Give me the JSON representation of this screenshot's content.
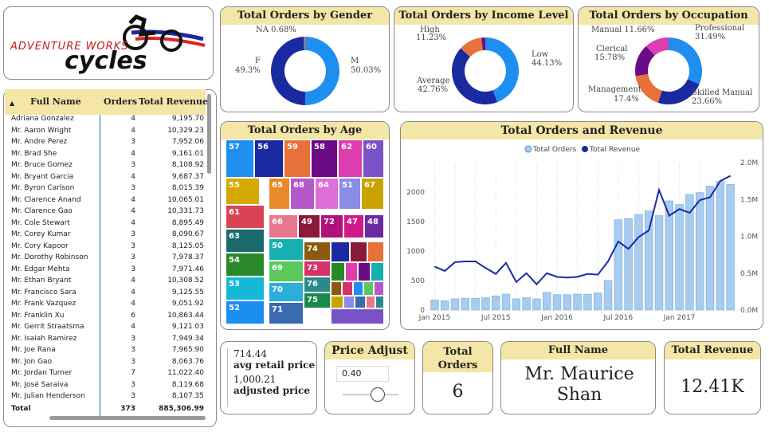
{
  "logo": {
    "line1": "ADVENTURE WORKS",
    "line2": "cycles"
  },
  "table": {
    "headers": {
      "name": "Full Name",
      "orders": "Orders",
      "revenue": "Total Revenue"
    },
    "rows": [
      {
        "name": "Adriana Gonzalez",
        "orders": "4",
        "revenue": "9,195.70"
      },
      {
        "name": "Mr. Aaron Wright",
        "orders": "4",
        "revenue": "10,329.23"
      },
      {
        "name": "Mr. Andre Perez",
        "orders": "3",
        "revenue": "7,952.06"
      },
      {
        "name": "Mr. Brad She",
        "orders": "4",
        "revenue": "9,161.01"
      },
      {
        "name": "Mr. Bruce Gomez",
        "orders": "3",
        "revenue": "8,108.92"
      },
      {
        "name": "Mr. Bryant Garcia",
        "orders": "4",
        "revenue": "9,687.37"
      },
      {
        "name": "Mr. Byron Carlson",
        "orders": "3",
        "revenue": "8,015.39"
      },
      {
        "name": "Mr. Clarence Anand",
        "orders": "4",
        "revenue": "10,065.01"
      },
      {
        "name": "Mr. Clarence Gao",
        "orders": "4",
        "revenue": "10,331.73"
      },
      {
        "name": "Mr. Cole Stewart",
        "orders": "4",
        "revenue": "8,895.49"
      },
      {
        "name": "Mr. Corey Kumar",
        "orders": "3",
        "revenue": "8,090.67"
      },
      {
        "name": "Mr. Cory Kapoor",
        "orders": "3",
        "revenue": "8,125.05"
      },
      {
        "name": "Mr. Dorothy Robinson",
        "orders": "3",
        "revenue": "7,978.37"
      },
      {
        "name": "Mr. Edgar Mehta",
        "orders": "3",
        "revenue": "7,971.46"
      },
      {
        "name": "Mr. Ethan Bryant",
        "orders": "4",
        "revenue": "10,308.52"
      },
      {
        "name": "Mr. Francisco Sara",
        "orders": "4",
        "revenue": "9,125.55"
      },
      {
        "name": "Mr. Frank Vazquez",
        "orders": "4",
        "revenue": "9,051.92"
      },
      {
        "name": "Mr. Franklin Xu",
        "orders": "6",
        "revenue": "10,863.44"
      },
      {
        "name": "Mr. Gerrit Straatsma",
        "orders": "4",
        "revenue": "9,121.03"
      },
      {
        "name": "Mr. Isaiah Ramirez",
        "orders": "3",
        "revenue": "7,949.34"
      },
      {
        "name": "Mr. Joe Rana",
        "orders": "3",
        "revenue": "7,965.90"
      },
      {
        "name": "Mr. Jon Gao",
        "orders": "3",
        "revenue": "8,063.76"
      },
      {
        "name": "Mr. Jordan Turner",
        "orders": "7",
        "revenue": "11,022.40"
      },
      {
        "name": "Mr. José Saraiva",
        "orders": "3",
        "revenue": "8,119.68"
      },
      {
        "name": "Mr. Julian Henderson",
        "orders": "3",
        "revenue": "8,107.35"
      }
    ],
    "total": {
      "name": "Total",
      "orders": "373",
      "revenue": "885,306.99"
    }
  },
  "gender": {
    "title": "Total Orders by Gender",
    "slices": [
      {
        "name": "M",
        "pct": "50.03%",
        "value": 50.03,
        "color": "#1f8ef1"
      },
      {
        "name": "F",
        "pct": "49.3%",
        "value": 49.3,
        "color": "#1a2aa0"
      },
      {
        "name": "NA",
        "pct": "0.68%",
        "value": 0.68,
        "color": "#e8713a"
      }
    ],
    "labels": {
      "na": "NA 0.68%",
      "f": "F",
      "f_pct": "49.3%",
      "m": "M",
      "m_pct": "50.03%"
    }
  },
  "income": {
    "title": "Total Orders by Income Level",
    "slices": [
      {
        "name": "Low",
        "pct": "44.13%",
        "value": 44.13,
        "color": "#1f8ef1"
      },
      {
        "name": "Average",
        "pct": "42.76%",
        "value": 42.76,
        "color": "#1a2aa0"
      },
      {
        "name": "High",
        "pct": "11.23%",
        "value": 11.23,
        "color": "#e8713a"
      },
      {
        "name": "",
        "pct": "",
        "value": 1.88,
        "color": "#6b0c86"
      }
    ],
    "labels": {
      "high": "High",
      "high_pct": "11.23%",
      "low": "Low",
      "low_pct": "44.13%",
      "avg": "Average",
      "avg_pct": "42.76%"
    }
  },
  "occupation": {
    "title": "Total Orders by Occupation",
    "slices": [
      {
        "name": "Professional",
        "pct": "31.49%",
        "value": 31.49,
        "color": "#1f8ef1"
      },
      {
        "name": "Skilled Manual",
        "pct": "23.66%",
        "value": 23.66,
        "color": "#1a2aa0"
      },
      {
        "name": "Management",
        "pct": "17.4%",
        "value": 17.4,
        "color": "#e8713a"
      },
      {
        "name": "Clerical",
        "pct": "15.78%",
        "value": 15.78,
        "color": "#6b0c86"
      },
      {
        "name": "Manual",
        "pct": "11.66%",
        "value": 11.66,
        "color": "#de3fb0"
      }
    ],
    "labels": {
      "manual": "Manual 11.66%",
      "prof": "Professional",
      "prof_pct": "31.49%",
      "cler": "Clerical",
      "cler_pct": "15.78%",
      "mgmt": "Management",
      "mgmt_pct": "17.4%",
      "skill": "Skilled Manual",
      "skill_pct": "23.66%"
    }
  },
  "age": {
    "title": "Total Orders by Age",
    "tiles": [
      "57",
      "56",
      "59",
      "58",
      "62",
      "60",
      "55",
      "65",
      "68",
      "64",
      "51",
      "67",
      "61",
      "66",
      "49",
      "72",
      "47",
      "48",
      "63",
      "50",
      "74",
      "54",
      "69",
      "73",
      "53",
      "70",
      "76",
      "52",
      "71",
      "75"
    ],
    "colors": [
      "#1f8ef1",
      "#1a2aa0",
      "#e8713a",
      "#6b0c86",
      "#de3fb0",
      "#7a52c8",
      "#d4a900",
      "#e88a2a",
      "#b45ac8",
      "#de6fd8",
      "#8b8be8",
      "#c8a300",
      "#d94455",
      "#e87890",
      "#8b1a3a",
      "#b0127a",
      "#d01a8a",
      "#6b2aa0",
      "#1a6a6a",
      "#16b0b0",
      "#8a5a10",
      "#2a8a2a",
      "#5ac85a",
      "#d4326a",
      "#16b8d8",
      "#2ab0d8",
      "#2a8a8a",
      "#1a8ef1",
      "#3a6ab0",
      "#1a8a4a"
    ]
  },
  "combo": {
    "title": "Total Orders and Revenue",
    "legend": [
      "Total Orders",
      "Total Revenue"
    ],
    "colors": {
      "bars": "#a8ccf0",
      "line": "#1a2aa0"
    },
    "y_ticks": [
      "0",
      "500",
      "1000",
      "1500",
      "2000"
    ],
    "y2_ticks": [
      "0.0M",
      "0.5M",
      "1.0M",
      "1.5M",
      "2.0M"
    ],
    "x_ticks": [
      "Jan 2015",
      "Jul 2015",
      "Jan 2016",
      "Jul 2016",
      "Jan 2017"
    ]
  },
  "chart_data": {
    "type": "bar",
    "title": "Total Orders and Revenue",
    "categories": [
      "Jan 2015",
      "Feb 2015",
      "Mar 2015",
      "Apr 2015",
      "May 2015",
      "Jun 2015",
      "Jul 2015",
      "Aug 2015",
      "Sep 2015",
      "Oct 2015",
      "Nov 2015",
      "Dec 2015",
      "Jan 2016",
      "Feb 2016",
      "Mar 2016",
      "Apr 2016",
      "May 2016",
      "Jun 2016",
      "Jul 2016",
      "Aug 2016",
      "Sep 2016",
      "Oct 2016",
      "Nov 2016",
      "Dec 2016",
      "Jan 2017",
      "Feb 2017",
      "Mar 2017",
      "Apr 2017",
      "May 2017",
      "Jun 2017"
    ],
    "series": [
      {
        "name": "Total Orders",
        "type": "bar",
        "axis": "left",
        "values": [
          170,
          160,
          190,
          200,
          200,
          210,
          240,
          270,
          190,
          210,
          190,
          300,
          260,
          260,
          270,
          270,
          290,
          500,
          1530,
          1550,
          1620,
          1680,
          1600,
          1850,
          1790,
          1960,
          1990,
          2100,
          2180,
          2130
        ]
      },
      {
        "name": "Total Revenue",
        "type": "line",
        "axis": "right",
        "values": [
          0.59,
          0.53,
          0.65,
          0.66,
          0.66,
          0.57,
          0.49,
          0.64,
          0.38,
          0.5,
          0.35,
          0.5,
          0.45,
          0.44,
          0.45,
          0.49,
          0.48,
          0.66,
          0.93,
          0.83,
          0.99,
          1.08,
          1.63,
          1.28,
          1.37,
          1.32,
          1.49,
          1.53,
          1.75,
          1.82
        ]
      }
    ],
    "ylim": [
      0,
      2350
    ],
    "y2lim": [
      0,
      2000000
    ],
    "legend_position": "top"
  },
  "price": {
    "avg_value": "714.44",
    "avg_label": "avg retail price",
    "adj_value": "1,000.21",
    "adj_label": "adjusted price",
    "adjust_title": "Price Adjust",
    "adjust_value": "0.40",
    "slider_level": 0.4
  },
  "kpis": {
    "orders_title": "Total Orders",
    "orders_value": "6",
    "name_title": "Full Name",
    "name_value": "Mr. Maurice Shan",
    "revenue_title": "Total Revenue",
    "revenue_value": "12.41K"
  }
}
